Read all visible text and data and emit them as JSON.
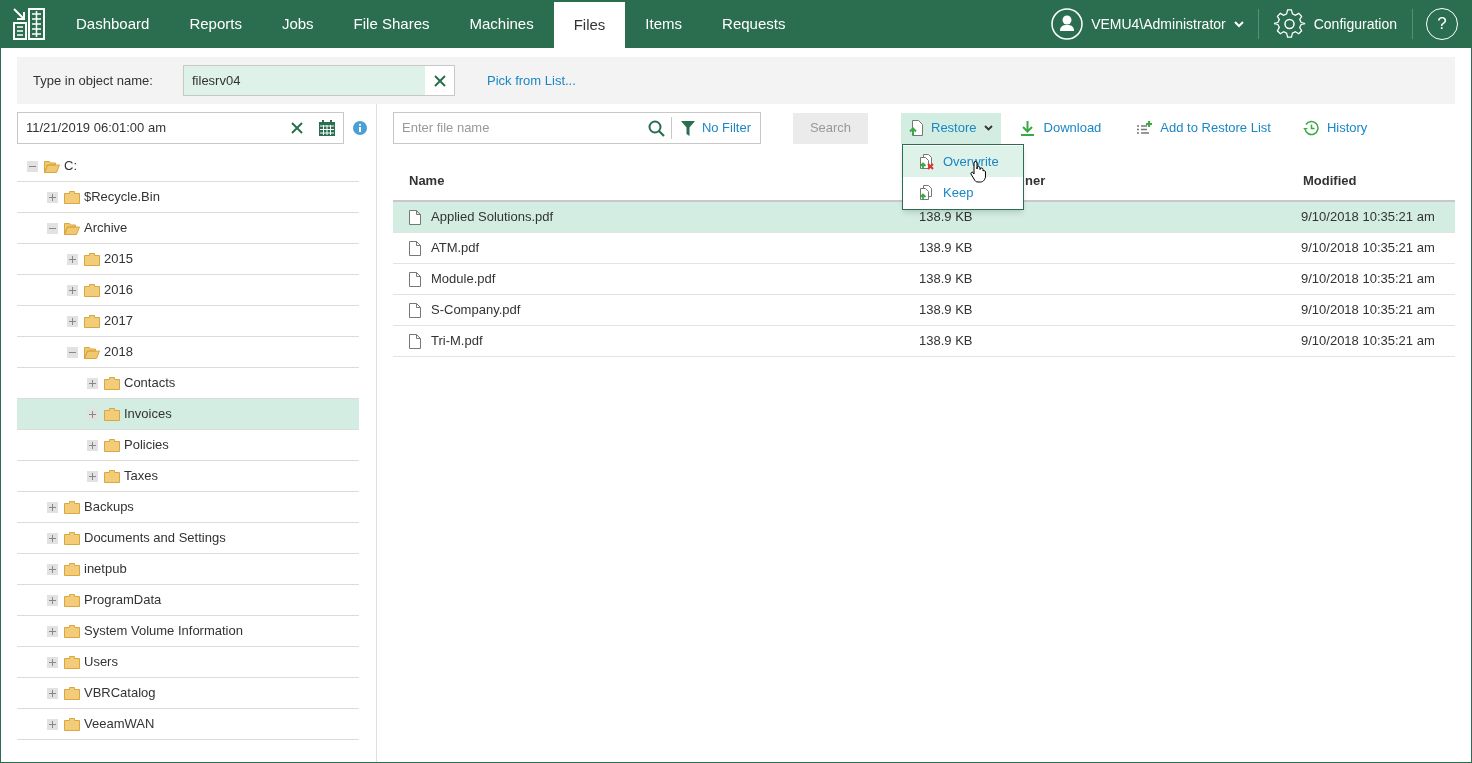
{
  "nav": {
    "tabs": [
      {
        "label": "Dashboard",
        "selected": false
      },
      {
        "label": "Reports",
        "selected": false
      },
      {
        "label": "Jobs",
        "selected": false
      },
      {
        "label": "File Shares",
        "selected": false
      },
      {
        "label": "Machines",
        "selected": false
      },
      {
        "label": "Files",
        "selected": true
      },
      {
        "label": "Items",
        "selected": false
      },
      {
        "label": "Requests",
        "selected": false
      }
    ],
    "user": "VEMU4\\Administrator",
    "configuration": "Configuration",
    "help": "?"
  },
  "object_bar": {
    "label": "Type in object name:",
    "value": "filesrv04",
    "pick_link": "Pick from List..."
  },
  "date_field": {
    "value": "11/21/2019 06:01:00 am"
  },
  "tree": [
    {
      "label": "C:",
      "expanded": true,
      "selected": false,
      "children": [
        {
          "label": "$Recycle.Bin",
          "expanded": false,
          "selected": false
        },
        {
          "label": "Archive",
          "expanded": true,
          "selected": false,
          "children": [
            {
              "label": "2015",
              "expanded": false,
              "selected": false
            },
            {
              "label": "2016",
              "expanded": false,
              "selected": false
            },
            {
              "label": "2017",
              "expanded": false,
              "selected": false
            },
            {
              "label": "2018",
              "expanded": true,
              "selected": false,
              "children": [
                {
                  "label": "Contacts",
                  "expanded": false,
                  "selected": false
                },
                {
                  "label": "Invoices",
                  "expanded": false,
                  "selected": true
                },
                {
                  "label": "Policies",
                  "expanded": false,
                  "selected": false
                },
                {
                  "label": "Taxes",
                  "expanded": false,
                  "selected": false
                }
              ]
            }
          ]
        },
        {
          "label": "Backups",
          "expanded": false,
          "selected": false
        },
        {
          "label": "Documents and Settings",
          "expanded": false,
          "selected": false
        },
        {
          "label": "inetpub",
          "expanded": false,
          "selected": false
        },
        {
          "label": "ProgramData",
          "expanded": false,
          "selected": false
        },
        {
          "label": "System Volume Information",
          "expanded": false,
          "selected": false
        },
        {
          "label": "Users",
          "expanded": false,
          "selected": false
        },
        {
          "label": "VBRCatalog",
          "expanded": false,
          "selected": false
        },
        {
          "label": "VeeamWAN",
          "expanded": false,
          "selected": false
        }
      ]
    }
  ],
  "toolbar": {
    "search_placeholder": "Enter file name",
    "filter": "No Filter",
    "search_button": {
      "label": "Search",
      "disabled": true
    },
    "restore": "Restore",
    "download": "Download",
    "add_to_restore_list": "Add to Restore List",
    "history": "History"
  },
  "restore_menu": [
    {
      "label": "Overwrite",
      "selected": true
    },
    {
      "label": "Keep",
      "selected": false
    }
  ],
  "table": {
    "headers": {
      "name": "Name",
      "owner": "ner",
      "modified": "Modified"
    },
    "rows": [
      {
        "name": "Applied Solutions.pdf",
        "size": "138.9 KB",
        "modified": "9/10/2018 10:35:21 am",
        "selected": true
      },
      {
        "name": "ATM.pdf",
        "size": "138.9 KB",
        "modified": "9/10/2018 10:35:21 am",
        "selected": false
      },
      {
        "name": "Module.pdf",
        "size": "138.9 KB",
        "modified": "9/10/2018 10:35:21 am",
        "selected": false
      },
      {
        "name": "S-Company.pdf",
        "size": "138.9 KB",
        "modified": "9/10/2018 10:35:21 am",
        "selected": false
      },
      {
        "name": "Tri-M.pdf",
        "size": "138.9 KB",
        "modified": "9/10/2018 10:35:21 am",
        "selected": false
      }
    ]
  }
}
